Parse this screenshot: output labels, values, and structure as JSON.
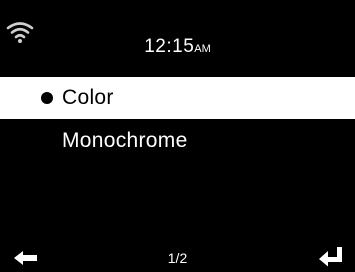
{
  "status_bar": {
    "wifi_icon": "wifi-icon",
    "time": "12:15",
    "ampm": "AM"
  },
  "menu": {
    "items": [
      {
        "label": "Color",
        "selected": true
      },
      {
        "label": "Monochrome",
        "selected": false
      }
    ]
  },
  "footer": {
    "back_icon": "back-arrow-icon",
    "page": "1/2",
    "enter_icon": "enter-icon"
  },
  "colors": {
    "background": "#000000",
    "foreground": "#ffffff",
    "highlight": "#ffffff"
  }
}
